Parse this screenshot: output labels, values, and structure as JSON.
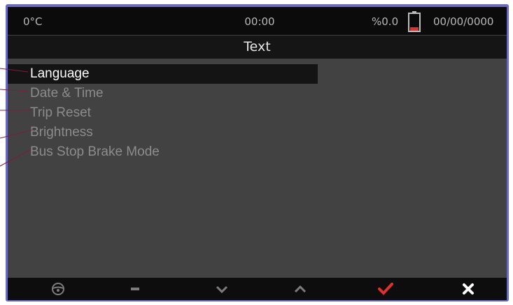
{
  "status": {
    "temperature": "0°C",
    "time": "00:00",
    "battery_percent": "%0.0",
    "battery_icon": "battery-low-icon",
    "date": "00/00/0000"
  },
  "title": "Text",
  "menu": {
    "selected_index": 0,
    "items": [
      {
        "label": "Language"
      },
      {
        "label": "Date & Time"
      },
      {
        "label": "Trip Reset"
      },
      {
        "label": "Brightness"
      },
      {
        "label": "Bus Stop Brake Mode"
      }
    ]
  },
  "softkeys": [
    {
      "icon": "steering-wheel-icon"
    },
    {
      "icon": "minus-icon"
    },
    {
      "icon": "chevron-down-icon"
    },
    {
      "icon": "chevron-up-icon"
    },
    {
      "icon": "checkmark-icon"
    },
    {
      "icon": "close-icon"
    }
  ],
  "colors": {
    "frame": "#6b6bbf",
    "screen_bg": "#424242",
    "bar_bg": "#0d0d0d",
    "selected_bg": "#141414",
    "accent_red": "#e03030",
    "callout_line": "#7a1f3a"
  }
}
